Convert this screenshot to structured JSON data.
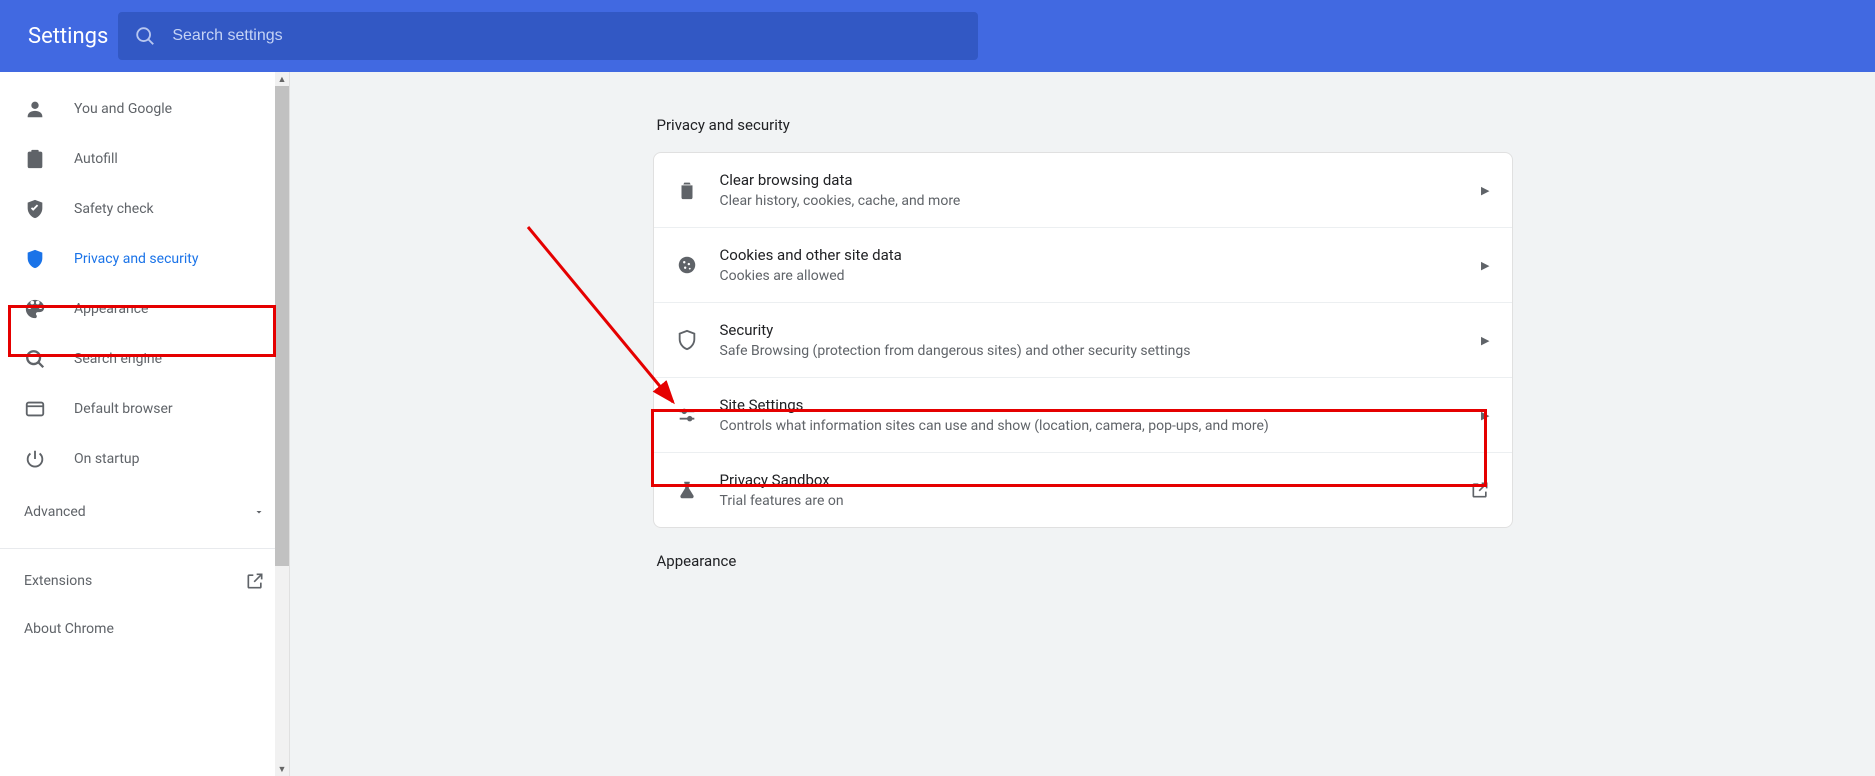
{
  "header": {
    "title": "Settings",
    "search_placeholder": "Search settings"
  },
  "sidebar": {
    "items": [
      {
        "label": "You and Google",
        "icon": "person"
      },
      {
        "label": "Autofill",
        "icon": "clipboard"
      },
      {
        "label": "Safety check",
        "icon": "shield-check"
      },
      {
        "label": "Privacy and security",
        "icon": "shield",
        "active": true
      },
      {
        "label": "Appearance",
        "icon": "palette"
      },
      {
        "label": "Search engine",
        "icon": "search"
      },
      {
        "label": "Default browser",
        "icon": "browser"
      },
      {
        "label": "On startup",
        "icon": "power"
      }
    ],
    "advanced_label": "Advanced",
    "extensions_label": "Extensions",
    "about_label": "About Chrome"
  },
  "main": {
    "section1_title": "Privacy and security",
    "rows": [
      {
        "title": "Clear browsing data",
        "sub": "Clear history, cookies, cache, and more",
        "icon": "trash"
      },
      {
        "title": "Cookies and other site data",
        "sub": "Cookies are allowed",
        "icon": "cookie"
      },
      {
        "title": "Security",
        "sub": "Safe Browsing (protection from dangerous sites) and other security settings",
        "icon": "shield-outline"
      },
      {
        "title": "Site Settings",
        "sub": "Controls what information sites can use and show (location, camera, pop-ups, and more)",
        "icon": "sliders"
      },
      {
        "title": "Privacy Sandbox",
        "sub": "Trial features are on",
        "icon": "flask",
        "external": true
      }
    ],
    "section2_title": "Appearance"
  }
}
